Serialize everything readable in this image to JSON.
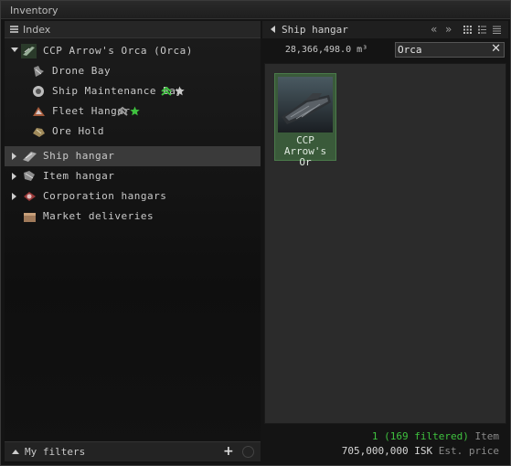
{
  "window": {
    "title": "Inventory"
  },
  "index": {
    "label": "Index",
    "tree": [
      {
        "label": "CCP Arrow's Orca (Orca)",
        "icon": "orca-ship-icon",
        "expanded": true
      },
      {
        "label": "Drone Bay",
        "icon": "drone-bay-icon"
      },
      {
        "label": "Ship Maintenance Bay",
        "icon": "ship-maintenance-bay-icon"
      },
      {
        "label": "Fleet Hangar",
        "icon": "fleet-hangar-icon"
      },
      {
        "label": "Ore Hold",
        "icon": "ore-hold-icon"
      },
      {
        "label": "Ship hangar",
        "icon": "ship-hangar-icon",
        "selected": true
      },
      {
        "label": "Item hangar",
        "icon": "item-hangar-icon"
      },
      {
        "label": "Corporation hangars",
        "icon": "corporation-hangars-icon"
      },
      {
        "label": "Market deliveries",
        "icon": "market-deliveries-icon"
      }
    ],
    "filters_label": "My filters"
  },
  "panel": {
    "title": "Ship hangar",
    "capacity": "28,366,498.0 m³",
    "search_value": "Orca",
    "items": [
      {
        "name": "CCP Arrow's Or"
      }
    ],
    "status": {
      "count": "1 (169 filtered)",
      "count_unit": "Item",
      "price": "705,000,000 ISK",
      "price_unit": "Est. price"
    }
  },
  "colors": {
    "accent_green": "#3fc23f",
    "selected_card": "#3a5a3a"
  }
}
